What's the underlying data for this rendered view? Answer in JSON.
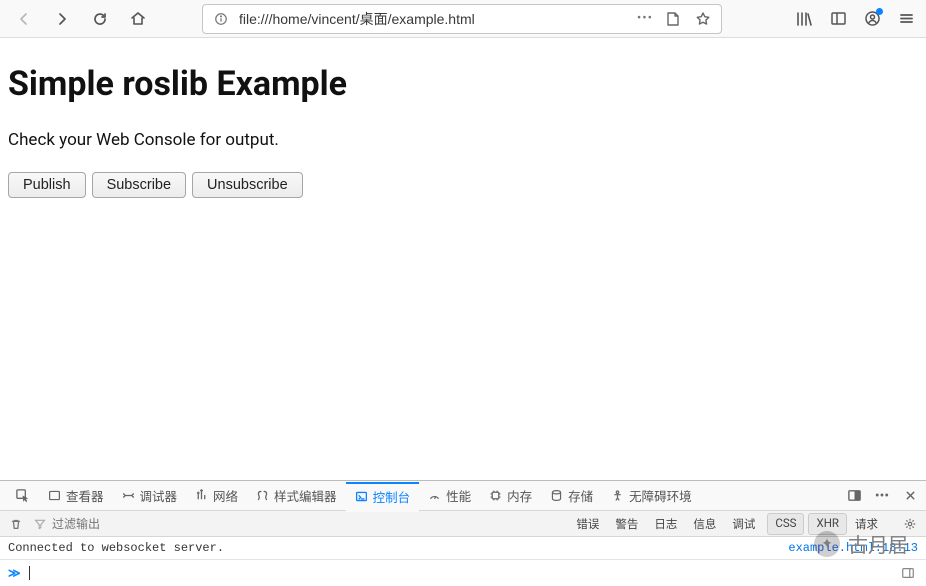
{
  "browser": {
    "url": "file:///home/vincent/桌面/example.html"
  },
  "page": {
    "heading": "Simple roslib Example",
    "subtext": "Check your Web Console for output.",
    "buttons": {
      "publish": "Publish",
      "subscribe": "Subscribe",
      "unsubscribe": "Unsubscribe"
    }
  },
  "devtools": {
    "tabs": {
      "inspector": "查看器",
      "debugger": "调试器",
      "network": "网络",
      "styleeditor": "样式编辑器",
      "console": "控制台",
      "performance": "性能",
      "memory": "内存",
      "storage": "存储",
      "accessibility": "无障碍环境"
    },
    "filter_placeholder": "过滤输出",
    "filters": {
      "error": "错误",
      "warn": "警告",
      "log": "日志",
      "info": "信息",
      "debug": "调试",
      "css": "CSS",
      "xhr": "XHR",
      "request": "请求"
    },
    "log_message": "Connected to websocket server.",
    "log_source": "example.html:18:13",
    "prompt": "≫"
  },
  "watermark": {
    "text": "古月居"
  }
}
